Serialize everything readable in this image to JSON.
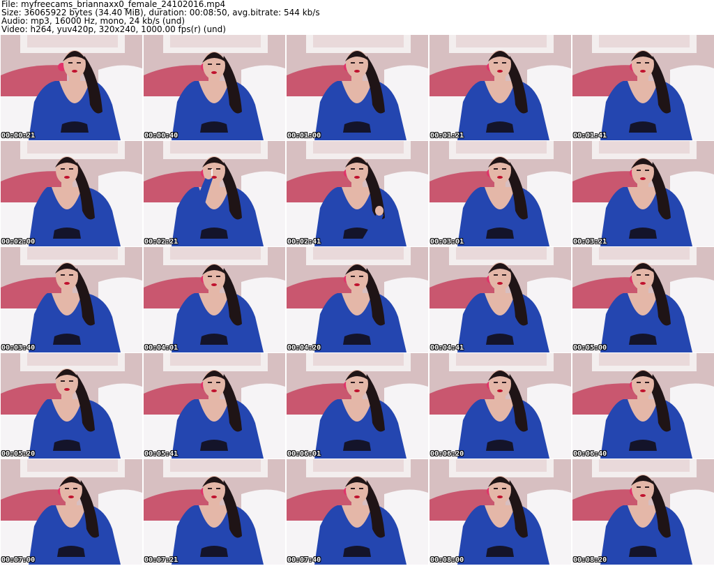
{
  "header": {
    "file_line": "File: myfreecams_briannaxx0_female_24102016.mp4",
    "size_line": "Size: 36065922 bytes (34.40 MiB), duration: 00:08:50, avg.bitrate: 544 kb/s",
    "audio_line": "Audio: mp3, 16000 Hz, mono, 24 kb/s (und)",
    "video_line": "Video: h264, yuv420p, 320x240, 1000.00 fps(r) (und)"
  },
  "colors": {
    "wall": "#d7bfc1",
    "frame": "#f3eeee",
    "headboard": "#c9576f",
    "pillow": "#f6f4f6",
    "dress": "#2446b0",
    "hair": "#1f1416",
    "skin": "#e4b7a8",
    "bra": "#14142a"
  },
  "thumbnails": [
    {
      "time": "00:00:21",
      "pose": "face-right"
    },
    {
      "time": "00:00:40",
      "pose": "face-down"
    },
    {
      "time": "00:01:00",
      "pose": "face-front"
    },
    {
      "time": "00:01:21",
      "pose": "face-front"
    },
    {
      "time": "00:01:41",
      "pose": "face-front"
    },
    {
      "time": "00:02:00",
      "pose": "face-left"
    },
    {
      "time": "00:02:21",
      "pose": "smoking"
    },
    {
      "time": "00:02:41",
      "pose": "hand-chest"
    },
    {
      "time": "00:03:01",
      "pose": "face-front"
    },
    {
      "time": "00:03:21",
      "pose": "face-down"
    },
    {
      "time": "00:03:40",
      "pose": "face-left"
    },
    {
      "time": "00:04:01",
      "pose": "face-down"
    },
    {
      "time": "00:04:20",
      "pose": "face-down"
    },
    {
      "time": "00:04:41",
      "pose": "face-front"
    },
    {
      "time": "00:05:00",
      "pose": "face-front"
    },
    {
      "time": "00:05:20",
      "pose": "face-left"
    },
    {
      "time": "00:05:41",
      "pose": "face-down"
    },
    {
      "time": "00:06:01",
      "pose": "face-down"
    },
    {
      "time": "00:06:20",
      "pose": "face-down"
    },
    {
      "time": "00:06:40",
      "pose": "face-down"
    },
    {
      "time": "00:07:00",
      "pose": "face-down"
    },
    {
      "time": "00:07:21",
      "pose": "face-down"
    },
    {
      "time": "00:07:40",
      "pose": "face-down"
    },
    {
      "time": "00:08:00",
      "pose": "face-down"
    },
    {
      "time": "00:08:20",
      "pose": "face-front"
    }
  ]
}
